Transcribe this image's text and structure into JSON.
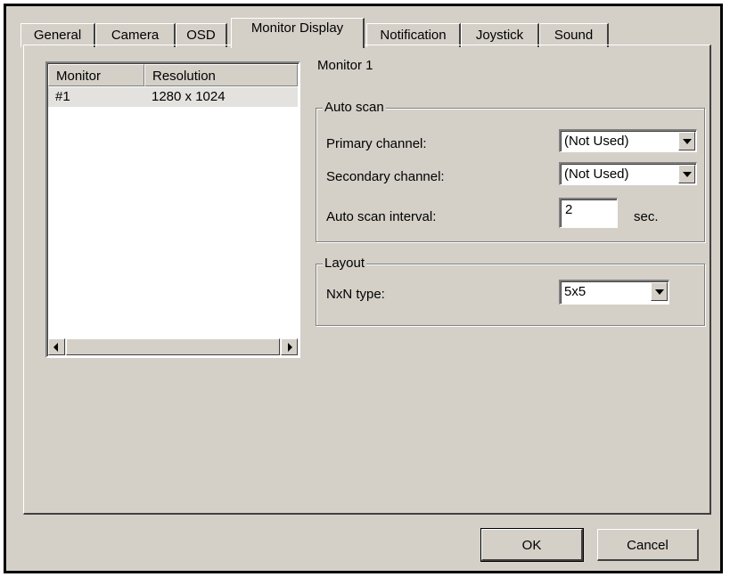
{
  "tabs": [
    {
      "label": "General",
      "active": false
    },
    {
      "label": "Camera",
      "active": false
    },
    {
      "label": "OSD",
      "active": false
    },
    {
      "label": "Monitor Display",
      "active": true
    },
    {
      "label": "Notification",
      "active": false
    },
    {
      "label": "Joystick",
      "active": false
    },
    {
      "label": "Sound",
      "active": false
    }
  ],
  "monitor_list": {
    "columns": [
      "Monitor",
      "Resolution"
    ],
    "rows": [
      {
        "monitor": "#1",
        "resolution": "1280 x 1024",
        "selected": true
      }
    ]
  },
  "details": {
    "heading": "Monitor 1",
    "auto_scan": {
      "title": "Auto scan",
      "primary_label": "Primary channel:",
      "primary_value": "(Not Used)",
      "secondary_label": "Secondary channel:",
      "secondary_value": "(Not Used)",
      "interval_label": "Auto scan interval:",
      "interval_value": "2",
      "interval_unit": "sec."
    },
    "layout": {
      "title": "Layout",
      "nxn_label": "NxN type:",
      "nxn_value": "5x5"
    }
  },
  "buttons": {
    "ok": "OK",
    "cancel": "Cancel"
  },
  "colors": {
    "window_bg": "#d4d0c8",
    "selected_row": "#e4e2de"
  }
}
